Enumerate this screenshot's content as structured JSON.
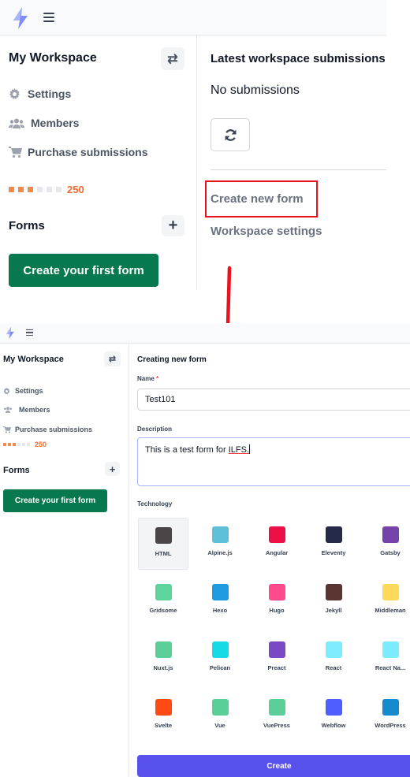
{
  "screen1": {
    "sidebar": {
      "workspace_title": "My Workspace",
      "nav": [
        {
          "label": "Settings",
          "icon": "gear-icon"
        },
        {
          "label": "Members",
          "icon": "users-icon"
        },
        {
          "label": "Purchase submissions",
          "icon": "cart-icon"
        }
      ],
      "usage": {
        "filled": 3,
        "total": 6,
        "value": "250",
        "color": "#f26b2e"
      },
      "forms_title": "Forms",
      "create_first_label": "Create your first form"
    },
    "main": {
      "latest_title": "Latest workspace submissions",
      "empty_text": "No submissions",
      "links": [
        "Create new form",
        "Workspace settings"
      ]
    },
    "annotation": {
      "highlighted": "Create new form",
      "color": "#e8131d"
    }
  },
  "screen2": {
    "sidebar": {
      "workspace_title": "My Workspace",
      "nav": [
        {
          "label": "Settings",
          "icon": "gear-icon"
        },
        {
          "label": "Members",
          "icon": "users-icon"
        },
        {
          "label": "Purchase submissions",
          "icon": "cart-icon"
        }
      ],
      "usage": {
        "filled": 3,
        "total": 6,
        "value": "250"
      },
      "forms_title": "Forms",
      "create_first_label": "Create your first form"
    },
    "form": {
      "title": "Creating new form",
      "name_label": "Name",
      "required_mark": "*",
      "name_value": "Test101",
      "description_label": "Description",
      "description_value_prefix": "This is a test form for ",
      "description_value_flagged": "ILFS.",
      "technology_label": "Technology",
      "selected_technology": "HTML",
      "technologies": [
        {
          "label": "HTML",
          "color": "#4a4546"
        },
        {
          "label": "Alpine.js",
          "color": "#5ec0d8"
        },
        {
          "label": "Angular",
          "color": "#ec1046"
        },
        {
          "label": "Eleventy",
          "color": "#252a4a"
        },
        {
          "label": "Gatsby",
          "color": "#7643ad"
        },
        {
          "label": "Gridsome",
          "color": "#5ed49c"
        },
        {
          "label": "Hexo",
          "color": "#1d9ae0"
        },
        {
          "label": "Hugo",
          "color": "#ff4a8d"
        },
        {
          "label": "Jekyll",
          "color": "#5a3532"
        },
        {
          "label": "Middleman",
          "color": "#ffd95a"
        },
        {
          "label": "Nuxt.js",
          "color": "#5ccf98"
        },
        {
          "label": "Pelican",
          "color": "#16dbe5"
        },
        {
          "label": "Preact",
          "color": "#7a4ac4"
        },
        {
          "label": "React",
          "color": "#7eecff"
        },
        {
          "label": "React Na...",
          "color": "#7eecff"
        },
        {
          "label": "Svelte",
          "color": "#ff4a15"
        },
        {
          "label": "Vue",
          "color": "#5ccf98"
        },
        {
          "label": "VuePress",
          "color": "#5ccf98"
        },
        {
          "label": "Webflow",
          "color": "#4f5fff"
        },
        {
          "label": "WordPress",
          "color": "#138bcc"
        }
      ],
      "create_label": "Create"
    }
  }
}
